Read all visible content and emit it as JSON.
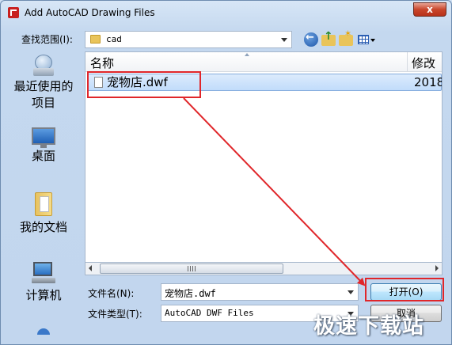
{
  "window": {
    "title": "Add AutoCAD Drawing Files",
    "close_label": "x"
  },
  "toolbar": {
    "lookin_label": "查找范围(I):",
    "lookin_value": "cad"
  },
  "places": [
    {
      "label_line1": "最近使用的",
      "label_line2": "项目"
    },
    {
      "label": "桌面"
    },
    {
      "label": "我的文档"
    },
    {
      "label": "计算机"
    }
  ],
  "file_list": {
    "columns": {
      "name": "名称",
      "date": "修改"
    },
    "rows": [
      {
        "name": "宠物店.dwf",
        "date": "2018"
      }
    ]
  },
  "form": {
    "filename_label": "文件名(N):",
    "filename_value": "宠物店.dwf",
    "filetype_label": "文件类型(T):",
    "filetype_value": "AutoCAD DWF Files"
  },
  "buttons": {
    "open": "打开(O)",
    "cancel": "取消"
  },
  "watermark": "极速下载站",
  "colors": {
    "annotation": "#e0262a",
    "selection": "#c1dcfb",
    "window_frame": "#c4d8ef"
  }
}
